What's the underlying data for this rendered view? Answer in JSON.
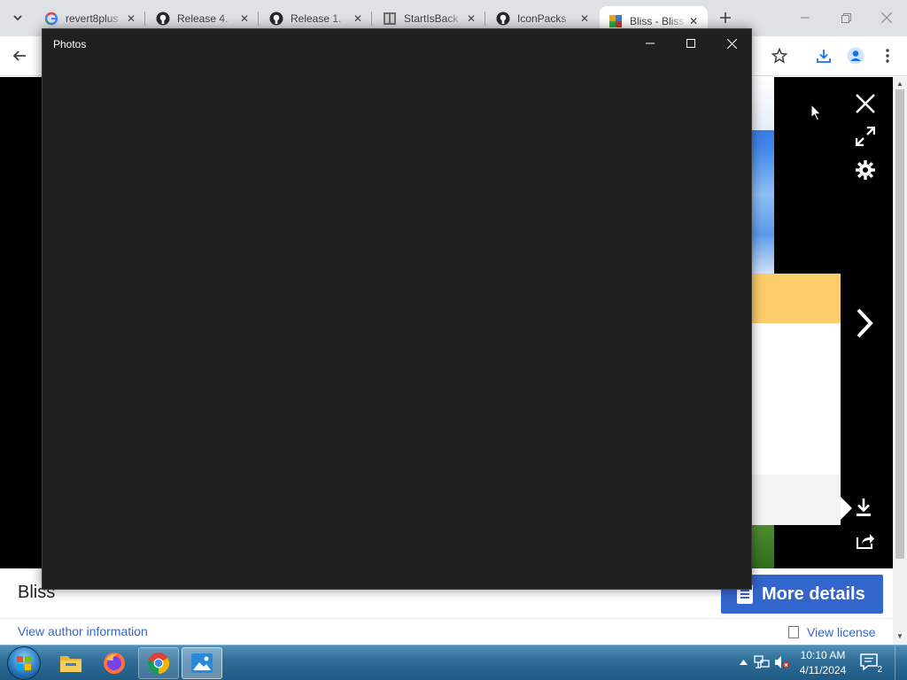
{
  "browser": {
    "tabs": [
      {
        "title": "revert8plus",
        "favicon": "google-icon",
        "active": false
      },
      {
        "title": "Release 4.",
        "favicon": "github-icon",
        "active": false
      },
      {
        "title": "Release 1.",
        "favicon": "github-icon",
        "active": false
      },
      {
        "title": "StartIsBack",
        "favicon": "startisback-icon",
        "active": false
      },
      {
        "title": "IconPacks",
        "favicon": "github-icon",
        "active": false
      },
      {
        "title": "Bliss - Bliss",
        "favicon": "wikimedia-commons-icon",
        "active": true
      }
    ]
  },
  "page": {
    "title": "Bliss",
    "more_details_label": "More details",
    "author_link": "View author information",
    "license_link": "View license"
  },
  "photos_window": {
    "title": "Photos"
  },
  "taskbar": {
    "apps": [
      "file-explorer-icon",
      "firefox-icon",
      "chrome-icon",
      "photos-icon"
    ],
    "clock_time": "10:10 AM",
    "clock_date": "4/11/2024",
    "notification_count": "2"
  },
  "colors": {
    "photos_bg": "#202020",
    "link": "#3366cc",
    "button": "#3366cc",
    "panel_yellow": "#fccd6a",
    "taskbar": "#2e6d96"
  }
}
